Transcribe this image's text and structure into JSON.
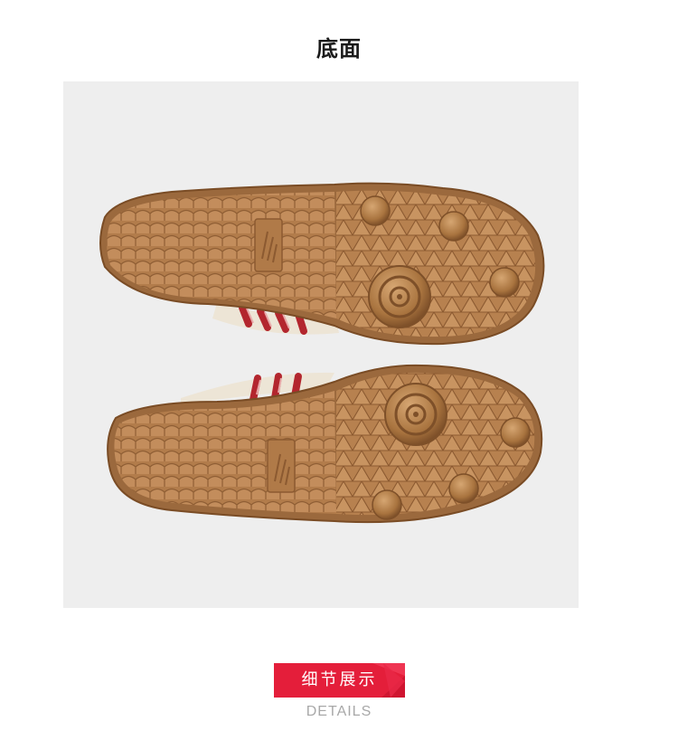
{
  "section": {
    "title": "底面"
  },
  "image": {
    "subject": "outsole",
    "shoe_count": 2
  },
  "details_badge": {
    "label": "细节展示",
    "subtitle": "DETAILS"
  },
  "colors": {
    "background": "#ffffff",
    "photo_background": "#eeeeee",
    "gum_sole": "#b5804f",
    "gum_dark": "#8c5a31",
    "stripe_red": "#b3262e",
    "upper_cream": "#ede5d6",
    "badge_red": "#e41e3a",
    "subtitle_gray": "#a8a8a8"
  }
}
